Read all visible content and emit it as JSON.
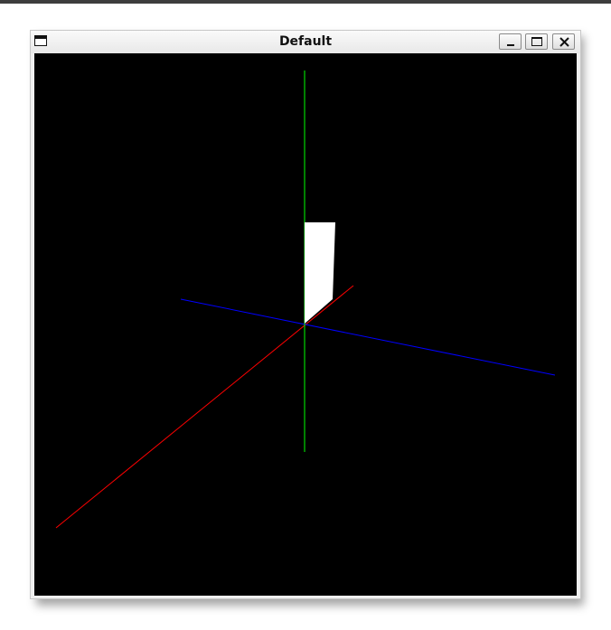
{
  "window": {
    "title": "Default"
  },
  "scene": {
    "background_color": "#000000",
    "object_color": "#ffffff",
    "axes": [
      {
        "name": "x-axis",
        "color": "#ff0000"
      },
      {
        "name": "y-axis",
        "color": "#00ff00"
      },
      {
        "name": "z-axis",
        "color": "#0000ff"
      }
    ]
  },
  "icons": {
    "menu": "window-menu-icon",
    "minimize": "minimize-icon",
    "maximize": "maximize-icon",
    "close": "close-icon"
  }
}
